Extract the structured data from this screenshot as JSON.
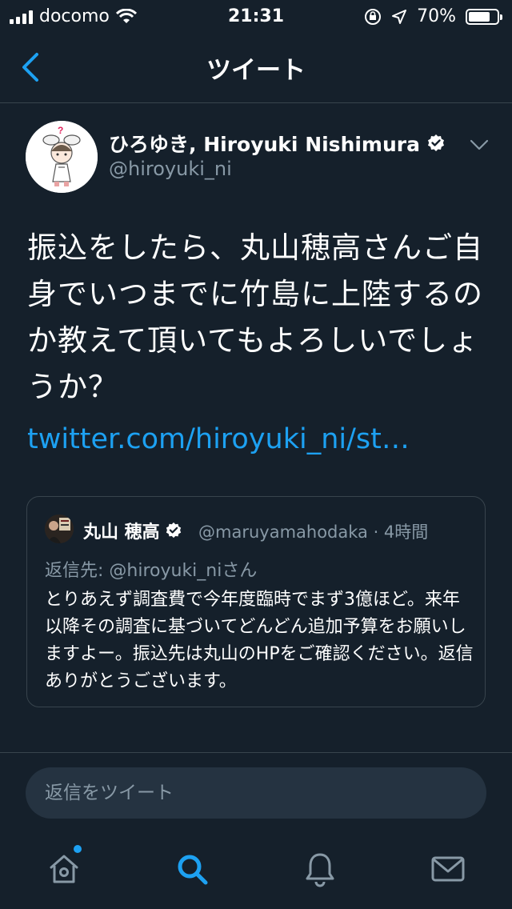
{
  "status_bar": {
    "carrier": "docomo",
    "time": "21:31",
    "battery": "70%"
  },
  "nav": {
    "title": "ツイート",
    "back_icon": "chevron-left-icon"
  },
  "tweet": {
    "author_name": "ひろゆき, Hiroyuki Nishimura",
    "author_handle": "@hiroyuki_ni",
    "verified": true,
    "text": "振込をしたら、丸山穂高さんご自身でいつまでに竹島に上陸するのか教えて頂いてもよろしいでしょうか？",
    "link": "twitter.com/hiroyuki_ni/st…",
    "quoted": {
      "name": "丸山 穂高",
      "handle_time": "@maruyamahodaka · 4時間",
      "reply_to": "返信先: @hiroyuki_niさん",
      "text": "とりあえず調査費で今年度臨時でまず3億ほど。来年以降その調査に基づいてどんどん追加予算をお願いしますよー。振込先は丸山のHPをご確認ください。返信ありがとうございます。"
    }
  },
  "reply": {
    "placeholder": "返信をツイート"
  },
  "tabs": [
    {
      "name": "home",
      "icon": "home-icon"
    },
    {
      "name": "search",
      "icon": "search-icon"
    },
    {
      "name": "notifications",
      "icon": "bell-icon"
    },
    {
      "name": "messages",
      "icon": "mail-icon"
    }
  ],
  "colors": {
    "background": "#15202b",
    "accent": "#1da1f2",
    "secondary_text": "#8899a6",
    "border": "#38444d"
  }
}
